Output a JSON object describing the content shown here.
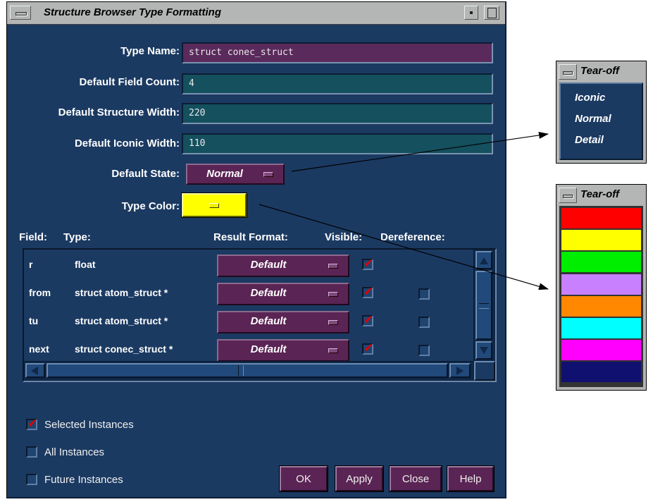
{
  "window": {
    "title": "Structure Browser Type Formatting"
  },
  "form": {
    "type_name_label": "Type Name:",
    "type_name_value": "struct conec_struct",
    "default_field_count_label": "Default Field Count:",
    "default_field_count_value": "4",
    "default_structure_width_label": "Default Structure Width:",
    "default_structure_width_value": "220",
    "default_iconic_width_label": "Default Iconic Width:",
    "default_iconic_width_value": "110",
    "default_state_label": "Default State:",
    "default_state_value": "Normal",
    "type_color_label": "Type Color:",
    "type_color_value": "#ffff00"
  },
  "table": {
    "headers": {
      "field": "Field:",
      "type": "Type:",
      "result_format": "Result Format:",
      "visible": "Visible:",
      "dereference": "Dereference:"
    },
    "rows": [
      {
        "field": "r",
        "type": "float",
        "result_format": "Default",
        "visible": true,
        "dereference": null
      },
      {
        "field": "from",
        "type": "struct atom_struct *",
        "result_format": "Default",
        "visible": true,
        "dereference": false
      },
      {
        "field": "tu",
        "type": "struct atom_struct *",
        "result_format": "Default",
        "visible": true,
        "dereference": false
      },
      {
        "field": "next",
        "type": "struct conec_struct *",
        "result_format": "Default",
        "visible": true,
        "dereference": false
      }
    ]
  },
  "instances": {
    "selected_label": "Selected Instances",
    "selected_checked": true,
    "all_label": "All Instances",
    "all_checked": false,
    "future_label": "Future Instances",
    "future_checked": false
  },
  "buttons": {
    "ok": "OK",
    "apply": "Apply",
    "close": "Close",
    "help": "Help"
  },
  "state_tearoff": {
    "title": "Tear-off",
    "items": [
      "Iconic",
      "Normal",
      "Detail"
    ]
  },
  "color_tearoff": {
    "title": "Tear-off",
    "colors": [
      "#ff0000",
      "#ffff00",
      "#00ee00",
      "#c880ff",
      "#ff8800",
      "#00ffff",
      "#ff00ff",
      "#101070"
    ]
  },
  "theme": {
    "panel_bg": "#1b3a62",
    "button_bg": "#5a2454",
    "check_color": "#e00000"
  }
}
